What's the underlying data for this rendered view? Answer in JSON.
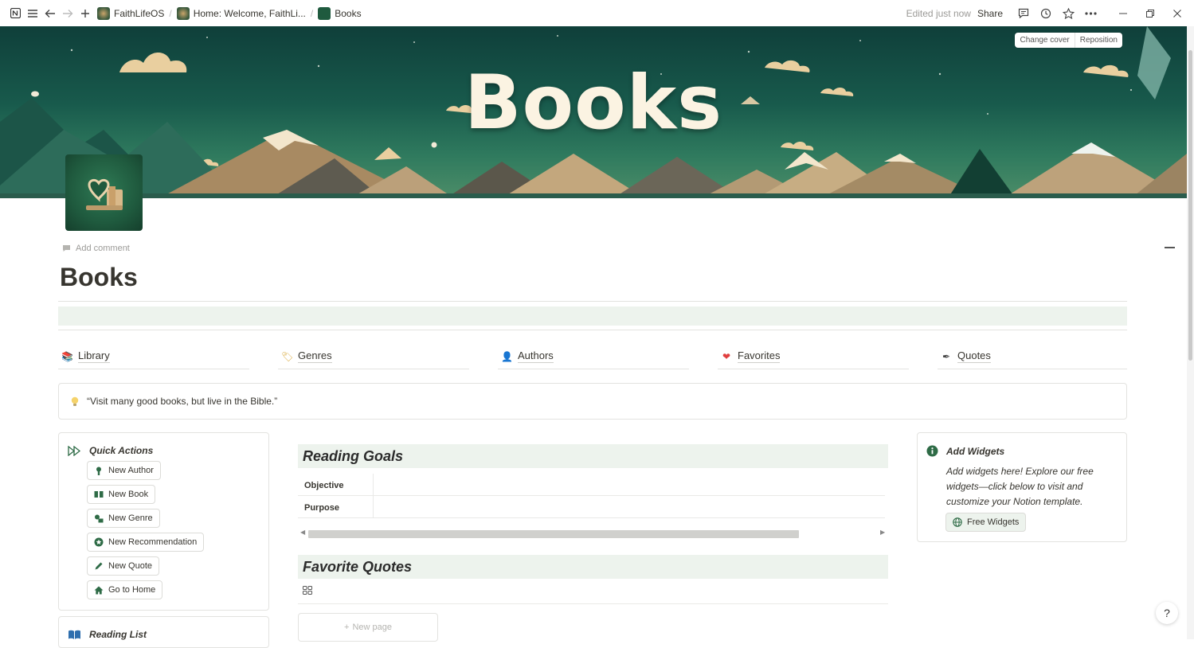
{
  "topbar": {
    "breadcrumbs": [
      "FaithLifeOS",
      "Home: Welcome, FaithLi...",
      "Books"
    ],
    "edited": "Edited just now",
    "share": "Share",
    "icons": [
      "notion-logo-icon",
      "menu-icon",
      "back-arrow-icon",
      "forward-arrow-icon",
      "plus-icon",
      "comments-icon",
      "history-icon",
      "star-icon",
      "more-icon",
      "minimize-icon",
      "restore-icon",
      "close-icon"
    ]
  },
  "cover": {
    "title": "Books",
    "change_cover": "Change cover",
    "reposition": "Reposition"
  },
  "page": {
    "add_comment": "Add comment",
    "title": "Books"
  },
  "nav": [
    {
      "label": "Library",
      "emoji": "📚"
    },
    {
      "label": "Genres",
      "emoji": "🏷"
    },
    {
      "label": "Authors",
      "emoji": "👤"
    },
    {
      "label": "Favorites",
      "emoji": "❤"
    },
    {
      "label": "Quotes",
      "emoji": "✒"
    }
  ],
  "callout": {
    "text": "“Visit many good books, but live in the Bible.”",
    "icon": "lightbulb-icon"
  },
  "quick_actions": {
    "title": "Quick Actions",
    "buttons": [
      "New Author",
      "New Book",
      "New Genre",
      "New Recommendation",
      "New Quote",
      "Go to Home"
    ]
  },
  "reading_list": {
    "title": "Reading List"
  },
  "reading_goals": {
    "title": "Reading Goals",
    "rows": [
      "Objective",
      "Purpose"
    ]
  },
  "favorite_quotes": {
    "title": "Favorite Quotes",
    "new_page": "New page"
  },
  "add_widgets": {
    "title": "Add Widgets",
    "body": "Add widgets here! Explore our free widgets—click below to visit and customize your Notion template.",
    "button": "Free Widgets"
  },
  "colors": {
    "accent_green": "#2e6b46",
    "tint_green": "#edf3ed",
    "cover_teal": "#185a4c",
    "heart_red": "#e03e3e"
  }
}
